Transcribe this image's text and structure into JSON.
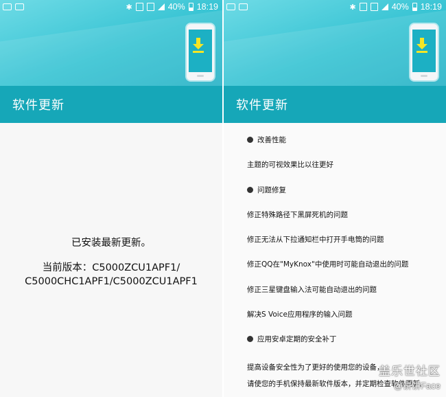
{
  "status_bar": {
    "battery": "40%",
    "time": "18:19",
    "icons": [
      "bluetooth-icon",
      "nfc-icon",
      "vibrate-icon",
      "signal-icon",
      "battery-icon"
    ]
  },
  "left_panel": {
    "title": "软件更新",
    "message_line1": "已安装最新更新。",
    "message_line2": "当前版本：C5000ZCU1APF1/",
    "message_line3": "C5000CHC1APF1/C5000ZCU1APF1"
  },
  "right_panel": {
    "title": "软件更新",
    "notes": [
      "改善性能",
      "主题的可视效果比以往更好",
      "问题修复",
      "修正特殊路径下黑屏死机的问题",
      "修正无法从下拉通知栏中打开手电筒的问题",
      "修正QQ在\"MyKnox\"中使用时可能自动退出的问题",
      "修正三星键盘输入法可能自动退出的问题",
      "解决S Voice应用程序的输入问题",
      "应用安卓定期的安全补丁",
      "提高设备安全性为了更好的使用您的设备，",
      "请使您的手机保持最新软件版本，并定期检查软件更新。"
    ]
  },
  "watermark": {
    "line1": "盖乐世社区",
    "line2": "@饼饼Face"
  },
  "colors": {
    "hero_light": "#6fdbe6",
    "hero_dark": "#26b2c6",
    "titlebar": "#16a7b8",
    "download_arrow": "#f5e625"
  }
}
